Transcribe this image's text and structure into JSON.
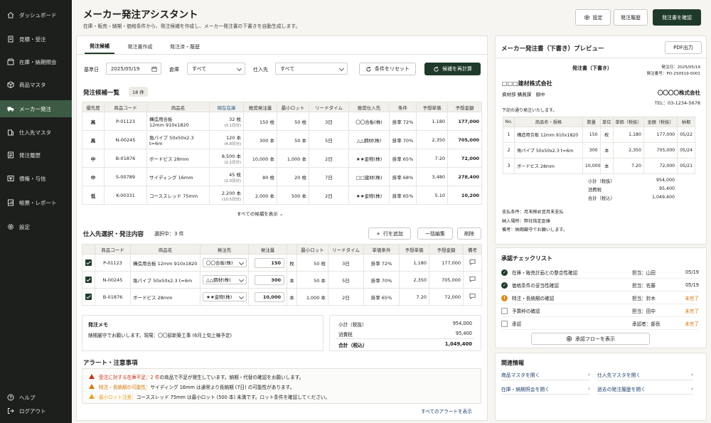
{
  "sidebar": {
    "items": [
      {
        "label": "ダッシュボード",
        "icon": "home-icon"
      },
      {
        "label": "見積・受注",
        "icon": "document-icon"
      },
      {
        "label": "在庫・納期照会",
        "icon": "box-icon"
      },
      {
        "label": "商品マスタ",
        "icon": "cube-icon"
      },
      {
        "label": "メーカー発注",
        "icon": "truck-icon"
      },
      {
        "label": "仕入先マスタ",
        "icon": "building-icon"
      },
      {
        "label": "発注履歴",
        "icon": "list-icon"
      },
      {
        "label": "債権・与信",
        "icon": "yen-icon"
      },
      {
        "label": "帳票・レポート",
        "icon": "report-icon"
      },
      {
        "label": "設定",
        "icon": "gear-icon"
      }
    ],
    "help": "ヘルプ",
    "logout": "ログアウト"
  },
  "header": {
    "title": "メーカー発注アシスタント",
    "subtitle": "在庫・販売・納期・価格条件から、発注候補を作成し、メーカー発注書の下書きを自動生成します。",
    "settings": "設定",
    "history": "発注履歴",
    "confirm": "発注書を確認"
  },
  "tabs": [
    "発注候補",
    "発注書作成",
    "発注済・履歴"
  ],
  "filters": {
    "base_date_label": "基準日",
    "base_date": "2025/05/19",
    "warehouse_label": "倉庫",
    "warehouse": "すべて",
    "supplier_label": "仕入先",
    "supplier": "すべて",
    "reset": "条件をリセット",
    "recalc": "候補を再計算"
  },
  "candidates": {
    "title": "発注候補一覧",
    "count": "18 件",
    "headers": [
      "優先度",
      "商品コード",
      "商品名",
      "現在在庫",
      "推奨発注量",
      "最小ロット",
      "リードタイム",
      "推奨仕入先",
      "条件",
      "予想単価",
      "予想金額"
    ],
    "rows": [
      {
        "priority": "高",
        "level": "hi",
        "code": "P-01123",
        "name1": "構造用合板",
        "name2": "12mm 910x1820",
        "stock": "32 枚",
        "stock_days": "(3.1日分)",
        "rec": "150 枚",
        "lot": "50 枚",
        "lead": "3日",
        "supplier": "〇〇合板(株)",
        "cond": "掛率 72%",
        "price": "1,180",
        "amount": "177,000"
      },
      {
        "priority": "高",
        "level": "hi",
        "code": "N-00245",
        "name1": "角パイプ 50x50x2.3 t=6m",
        "name2": "",
        "stock": "120 本",
        "stock_days": "(4.8日分)",
        "rec": "300 本",
        "lot": "50 本",
        "lead": "5日",
        "supplier": "△△鋼材(株)",
        "cond": "掛率 70%",
        "price": "2,350",
        "amount": "705,000"
      },
      {
        "priority": "中",
        "level": "mid",
        "code": "B-01876",
        "name1": "ボードビス 28mm",
        "name2": "",
        "stock": "8,500 本",
        "stock_days": "(2.2日分)",
        "rec": "10,000 本",
        "lot": "1,000 本",
        "lead": "2日",
        "supplier": "★★金物(株)",
        "cond": "掛率 65%",
        "price": "7.20",
        "amount": "72,000"
      },
      {
        "priority": "中",
        "level": "mid",
        "code": "S-00789",
        "name1": "サイディング 16mm",
        "name2": "",
        "stock": "45 枚",
        "stock_days": "(2.0日分)",
        "rec": "80 枚",
        "lot": "20 枚",
        "lead": "7日",
        "supplier": "□□建材(株)",
        "cond": "掛率 68%",
        "price": "3,480",
        "amount": "278,400"
      },
      {
        "priority": "低",
        "level": "low",
        "code": "K-00331",
        "name1": "コーススレッド 75mm",
        "name2": "",
        "stock": "2,200 本",
        "stock_days": "(10.5日分)",
        "rec": "2,000 本",
        "lot": "500 本",
        "lead": "2日",
        "supplier": "★★金物(株)",
        "cond": "掛率 65%",
        "price": "5.10",
        "amount": "10,200"
      }
    ],
    "show_all": "すべての候補を表示"
  },
  "selection": {
    "title": "仕入先選択・発注内容",
    "selected": "選択中：3 件",
    "add_row": "行を追加",
    "bulk_edit": "一括編集",
    "delete": "削除",
    "headers": [
      "",
      "商品コード",
      "商品名",
      "発注先",
      "発注量",
      "",
      "最小ロット",
      "リードタイム",
      "単価条件",
      "予想単価",
      "予想金額",
      "備考"
    ],
    "rows": [
      {
        "code": "P-01123",
        "name": "構造用合板 12mm 910x1820",
        "supplier": "〇〇合板(株)",
        "qty": "150",
        "unit": "枚",
        "lot": "50 枚",
        "lead": "3日",
        "cond": "掛率 72%",
        "price": "1,180",
        "amount": "177,000"
      },
      {
        "code": "N-00245",
        "name": "角パイプ 50x50x2.3 t=6m",
        "supplier": "△△鋼材(株)",
        "qty": "300",
        "unit": "本",
        "lot": "50 本",
        "lead": "5日",
        "cond": "掛率 70%",
        "price": "2,350",
        "amount": "705,000"
      },
      {
        "code": "B-01876",
        "name": "ボードビス 28mm",
        "supplier": "★★金物(株)",
        "qty": "10,000",
        "unit": "本",
        "lot": "1,000 本",
        "lead": "2日",
        "cond": "掛率 65%",
        "price": "7.20",
        "amount": "72,000"
      }
    ]
  },
  "memo": {
    "title": "発注メモ",
    "text": "納期厳守でお願いします。現場：〇〇邸新築工事 (6月上旬上棟予定)"
  },
  "totals": {
    "subtotal_label": "小計（税抜）",
    "subtotal": "954,000",
    "tax_label": "消費税",
    "tax": "95,400",
    "total_label": "合計（税込）",
    "total": "1,049,400"
  },
  "alerts": {
    "title": "アラート・注意事項",
    "items": [
      {
        "color": "#c8341e",
        "tag": "受注に対する在庫不足：",
        "tag2": "2 件",
        "text": "の商品で不足が発生しています。納期・代替の確認をお願いします。"
      },
      {
        "color": "#d67a12",
        "tag": "特注・長納期の可能性：",
        "tag2": "",
        "text": "サイディング 16mm は通常より長納期 (7日) の可能性があります。"
      },
      {
        "color": "#e8a020",
        "tag": "最小ロット注意：",
        "tag2": "",
        "text": "コーススレッド 75mm は最小ロット (500 本) 未満です。ロット条件を確認してください。"
      }
    ],
    "show_all": "すべてのアラートを表示"
  },
  "preview": {
    "title": "メーカー発注書（下書き）プレビュー",
    "pdf": "PDF出力",
    "doc_title": "発注書（下書き）",
    "issue_date": "発注日：2025/05/19",
    "doc_no": "発注番号：PO-250519-0001",
    "to_company": "□□□建材株式会社",
    "to_dept": "資材部 購買課　御中",
    "from_company": "〇〇〇〇株式会社",
    "from_tel": "TEL：03-1234-5678",
    "intro": "下記の通り発注いたします。",
    "headers": [
      "No.",
      "商品名・規格",
      "数量",
      "単位",
      "単価（税抜）",
      "金額（税抜）",
      "納期"
    ],
    "rows": [
      {
        "no": "1",
        "name": "構造用合板 12mm 910x1820",
        "qty": "150",
        "unit": "枚",
        "price": "1,180",
        "amount": "177,000",
        "due": "05/22"
      },
      {
        "no": "2",
        "name": "角パイプ 50x50x2.3 t=6m",
        "qty": "300",
        "unit": "本",
        "price": "2,350",
        "amount": "705,000",
        "due": "05/24"
      },
      {
        "no": "3",
        "name": "ボードビス 28mm",
        "qty": "10,000",
        "unit": "本",
        "price": "7.20",
        "amount": "72,000",
        "due": "05/21"
      }
    ],
    "subtotal_label": "小計（税抜）",
    "subtotal": "954,000",
    "tax_label": "消費税",
    "tax": "95,400",
    "total_label": "合計（税込）",
    "total": "1,049,400",
    "pay": "支払条件：月末締め翌月末支払",
    "place": "納入場所：弊社指定倉庫",
    "note": "備考：納期厳守でお願いします。"
  },
  "checklist": {
    "title": "承認チェックリスト",
    "items": [
      {
        "state": "done",
        "label": "在庫・販売計画との整合性確認",
        "who": "担当：山田",
        "status": "05/19"
      },
      {
        "state": "done",
        "label": "価格条件の妥当性確認",
        "who": "担当：佐藤",
        "status": "05/19"
      },
      {
        "state": "warn",
        "label": "特注・長納期の確認",
        "who": "担当：鈴木",
        "status": "未完了"
      },
      {
        "state": "todo",
        "label": "予算枠の確認",
        "who": "担当：田中",
        "status": "未完了"
      },
      {
        "state": "todo",
        "label": "承認",
        "who": "承認者：部長",
        "status": "未完了"
      }
    ],
    "flow": "承認フローを表示"
  },
  "related": {
    "title": "関連情報",
    "links": [
      "商品マスタを開く",
      "仕入先マスタを開く",
      "在庫・納期照会を開く",
      "過去の発注履歴を開く"
    ]
  },
  "colors": {
    "accent": "#1f3a29",
    "sidebar": "#1c1f1c",
    "high": "#c8341e",
    "mid": "#d67a12",
    "low": "#2c5c8a"
  }
}
